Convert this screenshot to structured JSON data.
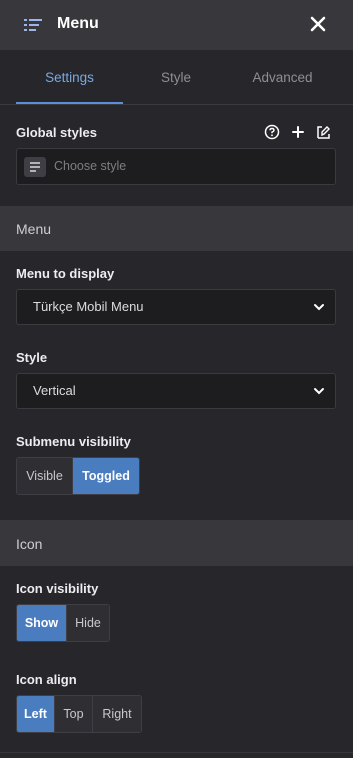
{
  "header": {
    "title": "Menu",
    "menu_icon": "list-icon",
    "close_icon": "close-icon"
  },
  "tabs": [
    {
      "label": "Settings",
      "active": true
    },
    {
      "label": "Style",
      "active": false
    },
    {
      "label": "Advanced",
      "active": false
    }
  ],
  "global_styles": {
    "label": "Global styles",
    "actions": [
      "help-icon",
      "plus-icon",
      "edit-style-icon"
    ],
    "placeholder": "Choose style"
  },
  "menu_section": {
    "title": "Menu",
    "menu_to_display": {
      "label": "Menu to display",
      "value": "Türkçe Mobil Menu"
    },
    "style": {
      "label": "Style",
      "value": "Vertical"
    },
    "submenu_visibility": {
      "label": "Submenu visibility",
      "options": [
        "Visible",
        "Toggled"
      ],
      "selected": "Toggled"
    }
  },
  "icon_section": {
    "title": "Icon",
    "icon_visibility": {
      "label": "Icon visibility",
      "options": [
        "Show",
        "Hide"
      ],
      "selected": "Show"
    },
    "icon_align": {
      "label": "Icon align",
      "options": [
        "Left",
        "Top",
        "Right"
      ],
      "selected": "Left"
    }
  },
  "colors": {
    "accent": "#4a7cc0",
    "tab_active": "#7aa8e0",
    "panel": "#27272b",
    "section_bg": "#37373c"
  }
}
